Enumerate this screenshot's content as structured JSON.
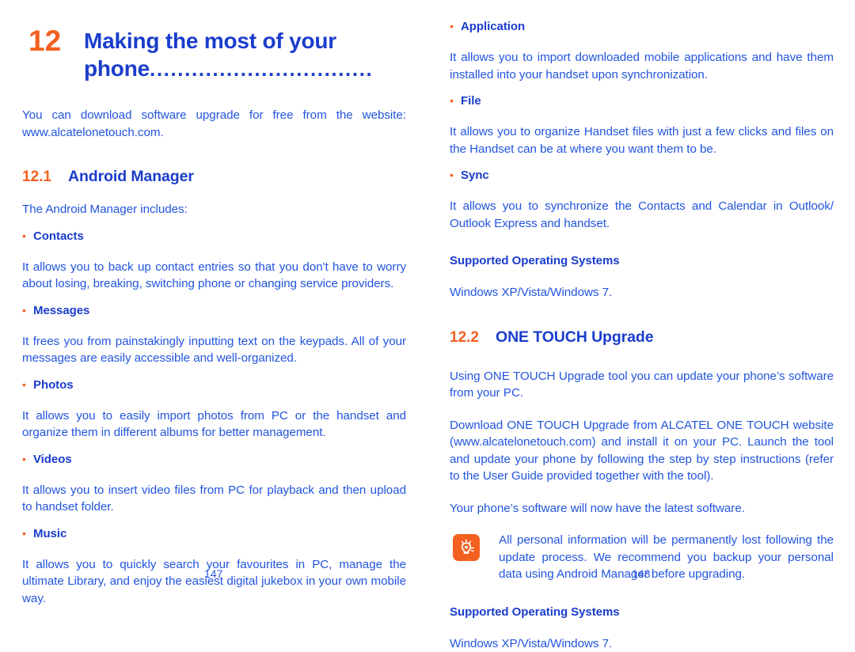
{
  "colors": {
    "accent_orange": "#F4601F",
    "heading_blue": "#1A3DCC",
    "body_blue": "#2255DD",
    "folio_blue": "#2B55E0",
    "page_background": "#FFFFFF"
  },
  "chapter": {
    "number": "12",
    "title_line1": "Making the most of your",
    "title_line2": "phone",
    "leader_dots": "................................"
  },
  "left_page": {
    "intro": "You can download software upgrade for free from the website: www.alcatelonetouch.com.",
    "section": {
      "number": "12.1",
      "name": "Android Manager"
    },
    "lead_in": "The Android Manager includes:",
    "bullet_marker": "•",
    "items": [
      {
        "label": "Contacts",
        "text": "It allows you to back up contact entries so that you don't have to worry about losing, breaking, switching phone or changing service providers."
      },
      {
        "label": "Messages",
        "text": "It frees you from painstakingly inputting text on the keypads. All of your messages are easily accessible and well-organized."
      },
      {
        "label": "Photos",
        "text": "It allows you to easily import photos from PC or the handset and organize them in different albums for better management."
      },
      {
        "label": "Videos",
        "text": "It allows you to insert video files from PC for playback and then upload to handset folder."
      },
      {
        "label": "Music",
        "text": "It allows you to quickly search your favourites in PC, manage the ultimate Library, and enjoy the easiest digital jukebox in your own mobile way."
      }
    ],
    "folio": "147"
  },
  "right_page": {
    "bullet_marker": "•",
    "items": [
      {
        "label": "Application",
        "text": "It allows you to import downloaded mobile applications and have them installed into your handset upon synchronization."
      },
      {
        "label": "File",
        "text": "It allows you to organize Handset files with just a few clicks and files on the Handset can be at where you want them to be."
      },
      {
        "label": "Sync",
        "text": "It allows you to synchronize the Contacts and Calendar in Outlook/ Outlook Express and handset."
      }
    ],
    "supported_os_heading_1": "Supported Operating Systems",
    "supported_os_value_1": "Windows XP/Vista/Windows 7.",
    "section": {
      "number": "12.2",
      "name": "ONE TOUCH Upgrade"
    },
    "paragraph_1": "Using ONE TOUCH Upgrade tool you can update your phone’s software from your PC.",
    "paragraph_2": "Download ONE TOUCH Upgrade from ALCATEL ONE TOUCH website (www.alcatelonetouch.com) and install it on your PC. Launch the tool and update your phone by following the step by step instructions (refer to the User Guide provided together with the tool).",
    "paragraph_3": "Your phone’s software will now have the latest software.",
    "note": {
      "icon": "tip-lightbulb-icon",
      "text": "All personal information will be permanently lost following the update process. We recommend you backup your personal data using Android Manager before upgrading."
    },
    "supported_os_heading_2": "Supported Operating Systems",
    "supported_os_value_2": "Windows XP/Vista/Windows 7.",
    "folio": "148"
  }
}
